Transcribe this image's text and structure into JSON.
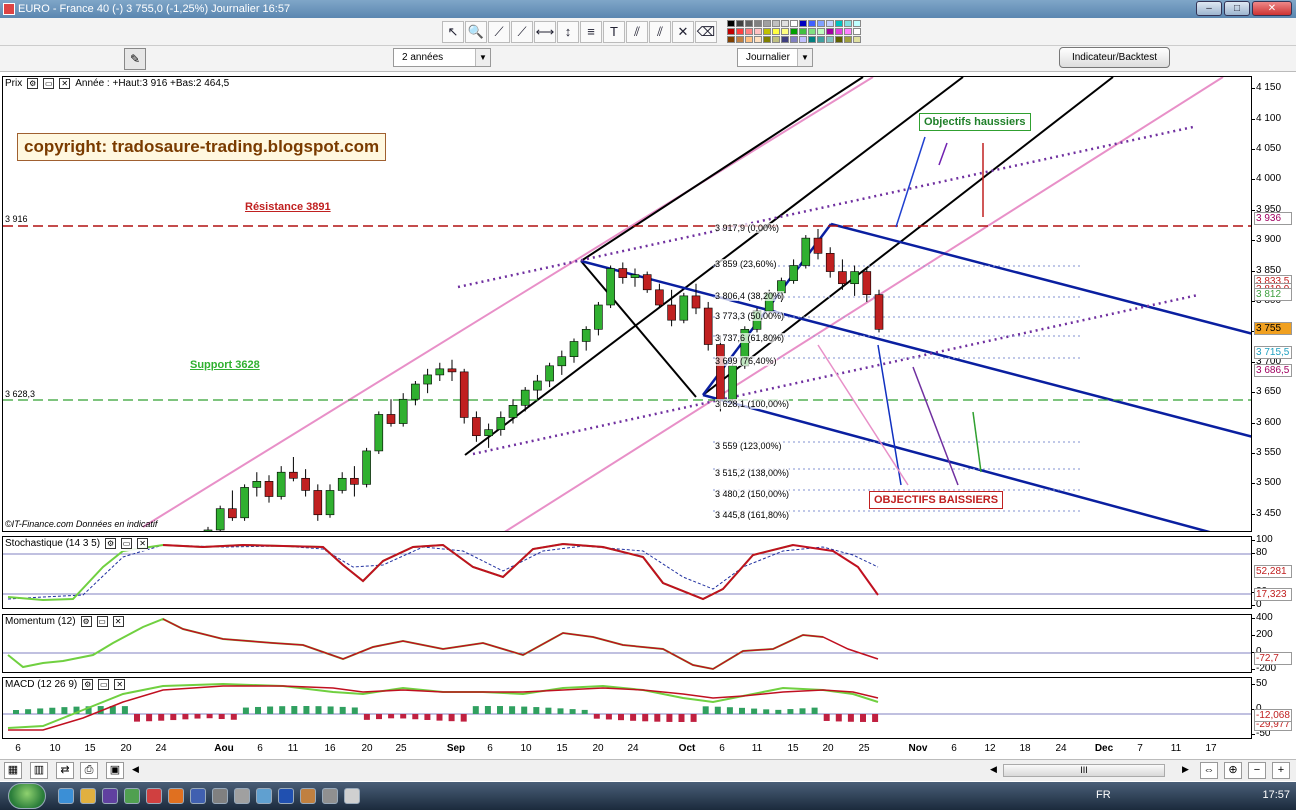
{
  "window": {
    "title": "EURO - France 40 (-)    3 755,0 (-1,25%)    Journalier  16:57",
    "buttons": [
      "minimize",
      "maximize",
      "close"
    ]
  },
  "toolbar": {
    "tools": [
      "pointer-icon",
      "zoom-icon",
      "line-icon",
      "trendline-icon",
      "horizontal-line-icon",
      "vertical-line-icon",
      "fibonacci-icon",
      "text-icon",
      "channel-icon",
      "parallel-icon",
      "tools-icon",
      "eraser-icon"
    ],
    "tool_glyphs": [
      "↖",
      "🔍",
      "⟋",
      "⟋",
      "⟷",
      "↕",
      "≡",
      "T",
      "⫽",
      "⫽",
      "✕",
      "⌫"
    ],
    "palette_colors": [
      "#000000",
      "#404040",
      "#606060",
      "#808080",
      "#a0a0a0",
      "#c0c0c0",
      "#e0e0e0",
      "#ffffff",
      "#0000c0",
      "#4060ff",
      "#80a0ff",
      "#c0d0ff",
      "#00c0c0",
      "#80e0e0",
      "#c0ffff",
      "#c00000",
      "#ff4040",
      "#ff8080",
      "#ffc0c0",
      "#c0c000",
      "#ffff40",
      "#ffff80",
      "#00a000",
      "#40c040",
      "#80e080",
      "#c0ffc0",
      "#a000a0",
      "#e040e0",
      "#ff80ff",
      "#ffffff",
      "#804000",
      "#c08040",
      "#ffc080",
      "#ffe0c0",
      "#808000",
      "#c0c080",
      "#404080",
      "#8080c0",
      "#c0c0ff",
      "#008080",
      "#40a0a0",
      "#80c0c0",
      "#606000",
      "#a0a040",
      "#e0e0a0"
    ]
  },
  "toolbar2": {
    "period": "2 années",
    "interval": "Journalier",
    "indicator_button": "Indicateur/Backtest"
  },
  "price_panel": {
    "title": "Prix",
    "range_label": "Année : +Haut:3 916 +Bas:2 464,5",
    "copyright": "copyright: tradosaure-trading.blogspot.com",
    "resistance": "Résistance 3891",
    "support": "Support 3628",
    "level_3916": "3 916",
    "level_3628": "3 628,3",
    "bull_label": "Objectifs haussiers",
    "bear_label": "OBJECTIFS BAISSIERS",
    "source": "©IT-Finance.com  Données en indicatif",
    "fib_levels": [
      "3 917,9 (0,00%)",
      "3 859 (23,60%)",
      "3 806,4 (38,20%)",
      "3 773,3 (50,00%)",
      "3 737,6 (61,80%)",
      "3 699 (76,40%)",
      "3 628,1 (100,00%)",
      "3 559 (123,00%)",
      "3 515,2 (138,00%)",
      "3 480,2 (150,00%)",
      "3 445,8 (161,80%)"
    ],
    "y_ticks": [
      "4 150",
      "4 100",
      "4 050",
      "4 000",
      "3 950",
      "3 900",
      "3 850",
      "3 800",
      "3 750",
      "3 700",
      "3 650",
      "3 600",
      "3 550",
      "3 500",
      "3 450"
    ],
    "y_values": [
      {
        "text": "3 936",
        "color": "#a00060"
      },
      {
        "text": "3 833,5",
        "color": "#c02020"
      },
      {
        "text": "3 819,9",
        "color": "#c02020"
      },
      {
        "text": "3 812",
        "color": "#40a040"
      },
      {
        "text": "3 755",
        "color": "#000000",
        "bg": "#f0a020"
      },
      {
        "text": "3 715,5",
        "color": "#20a0c0"
      },
      {
        "text": "3 686,5",
        "color": "#a00060"
      }
    ]
  },
  "stoch_panel": {
    "title": "Stochastique (14 3 5)",
    "y_ticks": [
      "100",
      "80",
      "20",
      "0"
    ],
    "values": [
      "52,281",
      "17,323"
    ]
  },
  "mom_panel": {
    "title": "Momentum (12)",
    "y_ticks": [
      "400",
      "200",
      "0",
      "-200"
    ],
    "values": [
      "-72,7"
    ]
  },
  "macd_panel": {
    "title": "MACD (12 26 9)",
    "y_ticks": [
      "50",
      "0",
      "-50"
    ],
    "values": [
      "-29,977",
      "-12,068"
    ]
  },
  "x_axis": [
    {
      "t": "6",
      "b": false
    },
    {
      "t": "10",
      "b": false
    },
    {
      "t": "15",
      "b": false
    },
    {
      "t": "20",
      "b": false
    },
    {
      "t": "24",
      "b": false
    },
    {
      "t": "Aou",
      "b": true
    },
    {
      "t": "6",
      "b": false
    },
    {
      "t": "11",
      "b": false
    },
    {
      "t": "16",
      "b": false
    },
    {
      "t": "20",
      "b": false
    },
    {
      "t": "25",
      "b": false
    },
    {
      "t": "Sep",
      "b": true
    },
    {
      "t": "6",
      "b": false
    },
    {
      "t": "10",
      "b": false
    },
    {
      "t": "15",
      "b": false
    },
    {
      "t": "20",
      "b": false
    },
    {
      "t": "24",
      "b": false
    },
    {
      "t": "Oct",
      "b": true
    },
    {
      "t": "6",
      "b": false
    },
    {
      "t": "11",
      "b": false
    },
    {
      "t": "15",
      "b": false
    },
    {
      "t": "20",
      "b": false
    },
    {
      "t": "25",
      "b": false
    },
    {
      "t": "Nov",
      "b": true
    },
    {
      "t": "6",
      "b": false
    },
    {
      "t": "12",
      "b": false
    },
    {
      "t": "18",
      "b": false
    },
    {
      "t": "24",
      "b": false
    },
    {
      "t": "Dec",
      "b": true
    },
    {
      "t": "7",
      "b": false
    },
    {
      "t": "11",
      "b": false
    },
    {
      "t": "17",
      "b": false
    }
  ],
  "bottombar": {
    "icons": [
      "grid-icon",
      "chart-type-icon",
      "compare-icon",
      "print-icon",
      "save-icon"
    ],
    "scroll_label": "III",
    "right_icons": [
      "fit-icon",
      "zoom-fit-icon",
      "zoom-out-icon",
      "zoom-in-icon"
    ]
  },
  "taskbar": {
    "lang": "FR",
    "clock": "17:57",
    "apps": [
      "ie-icon",
      "folder-icon",
      "media-icon",
      "app-icon",
      "chrome-icon",
      "firefox-icon",
      "app2-icon",
      "app3-icon",
      "app4-icon",
      "app5-icon",
      "word-icon",
      "app6-icon",
      "app7-icon",
      "app8-icon"
    ]
  },
  "chart_data": {
    "type": "candlestick",
    "instrument": "EURO - France 40",
    "last": 3755.0,
    "change_pct": -1.25,
    "ylim": [
      3420,
      4170
    ],
    "candles": [
      [
        3410,
        3430,
        3400,
        3425
      ],
      [
        3425,
        3465,
        3420,
        3460
      ],
      [
        3460,
        3490,
        3440,
        3445
      ],
      [
        3445,
        3500,
        3440,
        3495
      ],
      [
        3495,
        3520,
        3480,
        3505
      ],
      [
        3505,
        3515,
        3470,
        3480
      ],
      [
        3480,
        3530,
        3475,
        3520
      ],
      [
        3520,
        3545,
        3505,
        3510
      ],
      [
        3510,
        3525,
        3480,
        3490
      ],
      [
        3490,
        3500,
        3440,
        3450
      ],
      [
        3450,
        3500,
        3445,
        3490
      ],
      [
        3490,
        3520,
        3485,
        3510
      ],
      [
        3510,
        3530,
        3480,
        3500
      ],
      [
        3500,
        3560,
        3495,
        3555
      ],
      [
        3555,
        3620,
        3550,
        3615
      ],
      [
        3615,
        3640,
        3595,
        3600
      ],
      [
        3600,
        3650,
        3595,
        3640
      ],
      [
        3640,
        3670,
        3630,
        3665
      ],
      [
        3665,
        3690,
        3650,
        3680
      ],
      [
        3680,
        3700,
        3670,
        3690
      ],
      [
        3690,
        3705,
        3670,
        3685
      ],
      [
        3685,
        3690,
        3600,
        3610
      ],
      [
        3610,
        3620,
        3570,
        3580
      ],
      [
        3580,
        3600,
        3560,
        3590
      ],
      [
        3590,
        3620,
        3580,
        3610
      ],
      [
        3610,
        3640,
        3600,
        3630
      ],
      [
        3630,
        3660,
        3620,
        3655
      ],
      [
        3655,
        3680,
        3640,
        3670
      ],
      [
        3670,
        3700,
        3660,
        3695
      ],
      [
        3695,
        3720,
        3680,
        3710
      ],
      [
        3710,
        3740,
        3700,
        3735
      ],
      [
        3735,
        3760,
        3720,
        3755
      ],
      [
        3755,
        3800,
        3745,
        3795
      ],
      [
        3795,
        3860,
        3790,
        3855
      ],
      [
        3855,
        3865,
        3830,
        3840
      ],
      [
        3840,
        3855,
        3825,
        3845
      ],
      [
        3845,
        3850,
        3815,
        3820
      ],
      [
        3820,
        3830,
        3790,
        3795
      ],
      [
        3795,
        3820,
        3760,
        3770
      ],
      [
        3770,
        3815,
        3765,
        3810
      ],
      [
        3810,
        3830,
        3780,
        3790
      ],
      [
        3790,
        3800,
        3720,
        3730
      ],
      [
        3730,
        3745,
        3620,
        3640
      ],
      [
        3640,
        3700,
        3630,
        3695
      ],
      [
        3695,
        3760,
        3690,
        3755
      ],
      [
        3755,
        3790,
        3750,
        3785
      ],
      [
        3785,
        3820,
        3775,
        3815
      ],
      [
        3815,
        3840,
        3800,
        3835
      ],
      [
        3835,
        3870,
        3830,
        3860
      ],
      [
        3860,
        3910,
        3855,
        3905
      ],
      [
        3905,
        3920,
        3870,
        3880
      ],
      [
        3880,
        3890,
        3840,
        3850
      ],
      [
        3850,
        3870,
        3820,
        3830
      ],
      [
        3830,
        3860,
        3810,
        3850
      ],
      [
        3850,
        3855,
        3800,
        3812
      ],
      [
        3812,
        3820,
        3750,
        3755
      ]
    ],
    "title": "",
    "xlabel": "",
    "ylabel": ""
  }
}
